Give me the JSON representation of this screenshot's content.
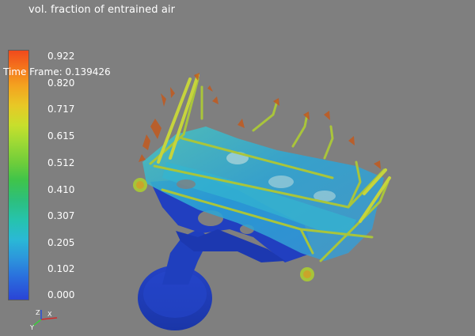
{
  "title": "vol. fraction of entrained air",
  "time_frame": "Time Frame: 0.139426",
  "legend": {
    "ticks": [
      "0.922",
      "0.820",
      "0.717",
      "0.615",
      "0.512",
      "0.410",
      "0.307",
      "0.205",
      "0.102",
      "0.000"
    ],
    "colors": {
      "max": "#f04a1c",
      "mid": "#3fc44a",
      "min": "#2a44d6"
    }
  },
  "axes": {
    "x_label": "X",
    "y_label": "Y",
    "z_label": "Z"
  },
  "colors": {
    "background": "#7f7f7f",
    "casting_base": "#1f3fb6",
    "casting_mid": "#2c9bd3",
    "casting_edge": "#9ac53a"
  }
}
